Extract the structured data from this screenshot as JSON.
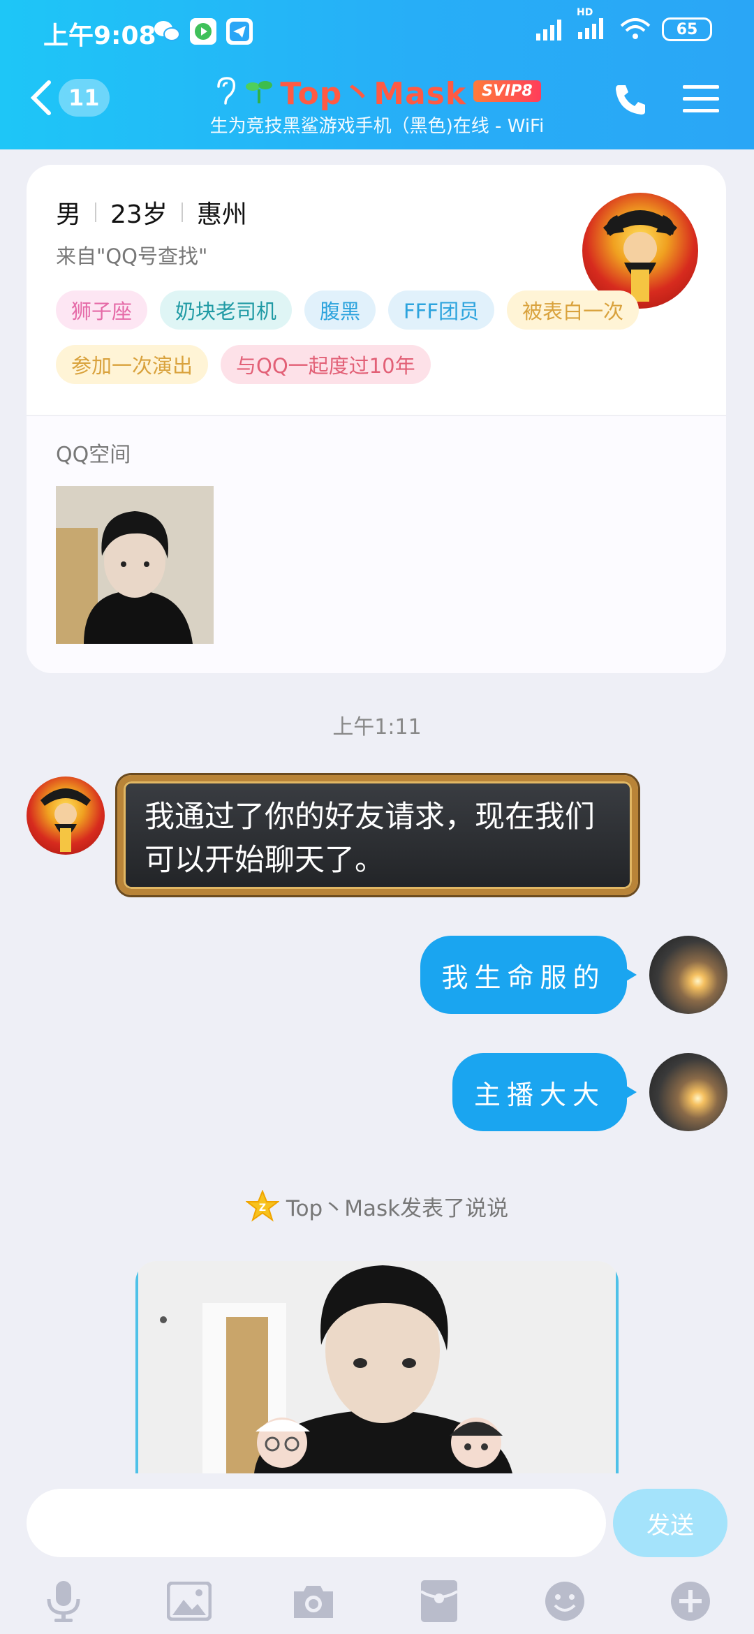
{
  "status": {
    "time": "上午9:08",
    "battery": "65",
    "network": "HD"
  },
  "header": {
    "back_count": "11",
    "contact_name": "Top丶Mask",
    "vip_badge": "SVIP8",
    "subtitle": "生为竞技黑鲨游戏手机（黑色)在线 - WiFi"
  },
  "profile": {
    "gender": "男",
    "age": "23岁",
    "location": "惠州",
    "source": "来自\"QQ号查找\"",
    "tags": [
      "狮子座",
      "奶块老司机",
      "腹黑",
      "FFF团员",
      "被表白一次",
      "参加一次演出",
      "与QQ一起度过10年"
    ],
    "qzone_label": "QQ空间"
  },
  "chat": {
    "timestamp": "上午1:11",
    "messages": [
      {
        "from": "them",
        "text": "我通过了你的好友请求，现在我们可以开始聊天了。"
      },
      {
        "from": "me",
        "text": "我生命服的"
      },
      {
        "from": "me",
        "text": "主播大大"
      }
    ],
    "feed_notice": "Top丶Mask发表了说说"
  },
  "input": {
    "placeholder": "",
    "send_label": "发送"
  },
  "toolbar": {
    "icons": [
      "microphone-icon",
      "image-icon",
      "camera-icon",
      "red-packet-icon",
      "emoji-icon",
      "plus-icon"
    ]
  },
  "colors": {
    "header_start": "#1ec6f7",
    "header_end": "#2aa6f6",
    "bubble_me": "#1aa5f0",
    "name_red": "#ff5a43"
  }
}
